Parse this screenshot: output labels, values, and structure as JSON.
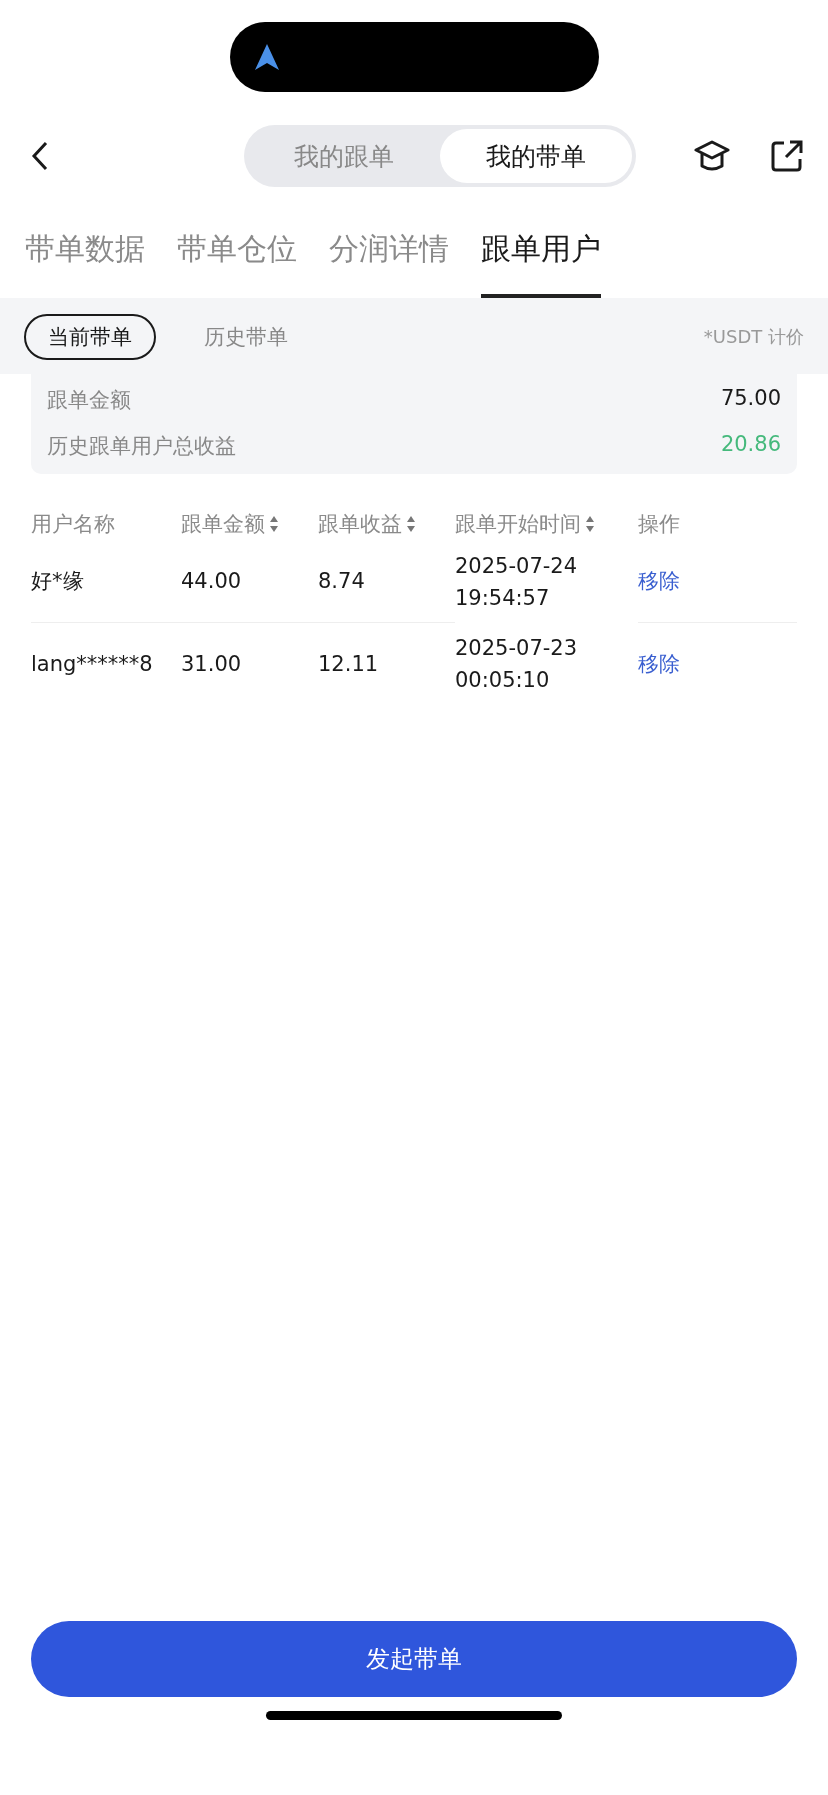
{
  "segment": [
    {
      "label": "我的跟单",
      "selected": false
    },
    {
      "label": "我的带单",
      "selected": true
    }
  ],
  "tabs": [
    {
      "label": "带单数据",
      "selected": false
    },
    {
      "label": "带单仓位",
      "selected": false
    },
    {
      "label": "分润详情",
      "selected": false
    },
    {
      "label": "跟单用户",
      "selected": true
    }
  ],
  "filters": [
    {
      "label": "当前带单",
      "selected": true
    },
    {
      "label": "历史带单",
      "selected": false
    }
  ],
  "currency_note": "*USDT 计价",
  "summary": [
    {
      "label": "跟单金额",
      "value": "75.00",
      "kind": "plain"
    },
    {
      "label": "历史跟单用户总收益",
      "value": "20.86",
      "kind": "profit"
    }
  ],
  "table": {
    "columns": [
      {
        "label": "用户名称",
        "sortable": false
      },
      {
        "label": "跟单金额",
        "sortable": true
      },
      {
        "label": "跟单收益",
        "sortable": true
      },
      {
        "label": "跟单开始时间",
        "sortable": true
      },
      {
        "label": "操作",
        "sortable": false
      }
    ],
    "rows": [
      {
        "user": "好*缘",
        "amount": "44.00",
        "profit": "8.74",
        "date": "2025-07-24",
        "time": "19:54:57",
        "action": "移除"
      },
      {
        "user": "lang******8",
        "amount": "31.00",
        "profit": "12.11",
        "date": "2025-07-23",
        "time": "00:05:10",
        "action": "移除"
      }
    ]
  },
  "primary_button": "发起带单"
}
